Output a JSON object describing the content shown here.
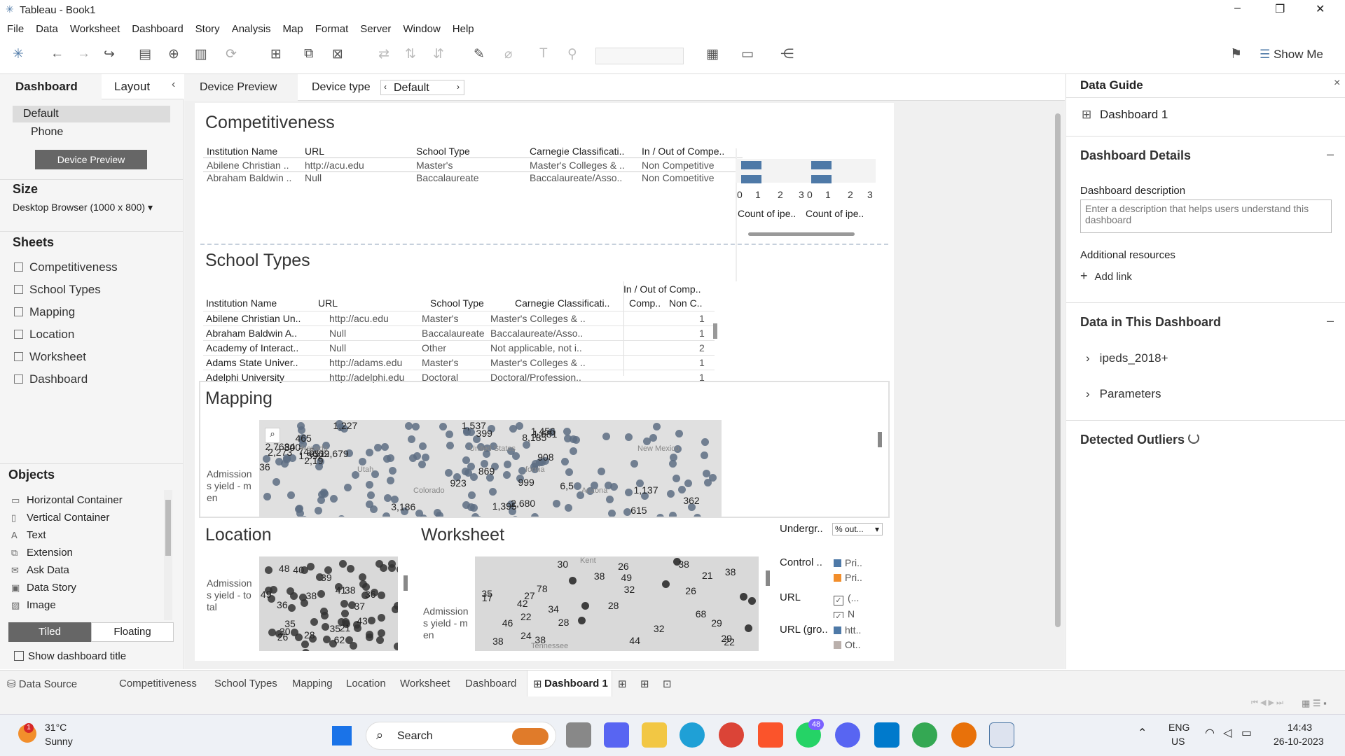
{
  "window": {
    "title": "Tableau - Book1",
    "min": "–",
    "max": "❐",
    "close": "✕"
  },
  "menu": [
    "File",
    "Data",
    "Worksheet",
    "Dashboard",
    "Story",
    "Analysis",
    "Map",
    "Format",
    "Server",
    "Window",
    "Help"
  ],
  "toolbar": {
    "show_me": "Show Me"
  },
  "left_panel": {
    "tab_dashboard": "Dashboard",
    "tab_layout": "Layout",
    "collapse": "‹",
    "device_default": "Default",
    "device_phone": "Phone",
    "device_preview_btn": "Device Preview",
    "size_title": "Size",
    "size_value": "Desktop Browser (1000 x 800)",
    "sheets_title": "Sheets",
    "sheets": [
      "Competitiveness",
      "School Types",
      "Mapping",
      "Location",
      "Worksheet",
      "Dashboard"
    ],
    "objects_title": "Objects",
    "objects": [
      {
        "icon": "▭",
        "label": "Horizontal Container"
      },
      {
        "icon": "▯",
        "label": "Vertical Container"
      },
      {
        "icon": "A",
        "label": "Text"
      },
      {
        "icon": "⧉",
        "label": "Extension"
      },
      {
        "icon": "✉",
        "label": "Ask Data"
      },
      {
        "icon": "▣",
        "label": "Data Story"
      },
      {
        "icon": "▨",
        "label": "Image"
      }
    ],
    "tiled": "Tiled",
    "floating": "Floating",
    "show_title": "Show dashboard title"
  },
  "dash_tabs": {
    "device_preview": "Device Preview",
    "device_type": "Device type",
    "device_type_value": "Default"
  },
  "competitiveness": {
    "title": "Competitiveness",
    "headers": [
      "Institution Name",
      "URL",
      "School Type",
      "Carnegie Classificati..",
      "In / Out of Compe.."
    ],
    "rows": [
      [
        "Abilene Christian ..",
        "http://acu.edu",
        "Master's",
        "Master's Colleges & ..",
        "Non Competitive"
      ],
      [
        "Abraham Baldwin ..",
        "Null",
        "Baccalaureate",
        "Baccalaureate/Asso..",
        "Non Competitive"
      ]
    ],
    "axis1": [
      "0",
      "1",
      "2",
      "3"
    ],
    "axis2": [
      "0",
      "1",
      "2",
      "3"
    ],
    "bars1": [
      1,
      1
    ],
    "bars2": [
      1,
      1
    ],
    "axis_label1": "Count of ipe..",
    "axis_label2": "Count of ipe.."
  },
  "school_types": {
    "title": "School Types",
    "super_header": "In / Out of Comp..",
    "headers": [
      "Institution Name",
      "URL",
      "School Type",
      "Carnegie Classificati..",
      "Comp..",
      "Non C.."
    ],
    "rows": [
      [
        "Abilene Christian Un..",
        "http://acu.edu",
        "Master's",
        "Master's Colleges & ..",
        "",
        "1"
      ],
      [
        "Abraham Baldwin A..",
        "Null",
        "Baccalaureate",
        "Baccalaureate/Asso..",
        "",
        "1"
      ],
      [
        "Academy of Interact..",
        "Null",
        "Other",
        "Not applicable, not i..",
        "",
        "2"
      ],
      [
        "Adams State Univer..",
        "http://adams.edu",
        "Master's",
        "Master's Colleges & ..",
        "",
        "1"
      ],
      [
        "Adelphi University",
        "http://adelphi.edu",
        "Doctoral",
        "Doctoral/Profession..",
        "",
        "1"
      ]
    ]
  },
  "mapping": {
    "title": "Mapping",
    "row_label": "Admission s yield - m en",
    "labels": [
      "999",
      "399",
      "36",
      "1,537",
      "1,681",
      "745",
      "923",
      "362",
      "1,227",
      "615",
      "1,137",
      "2,680",
      "2,273",
      "1,456",
      "908",
      "3,186",
      "8,185",
      "6,5",
      "2,7684",
      "309",
      "300",
      "869",
      "1,395",
      "1,592",
      "465",
      "2,679",
      "651",
      "2,19"
    ],
    "places": [
      "Nevada",
      "Utah",
      "Colorado",
      "United States",
      "fornia",
      "Arizona",
      "New Mexico"
    ]
  },
  "location": {
    "title": "Location",
    "row_label": "Admission s yield - to tal",
    "labels": [
      "49",
      "62",
      "38",
      "36",
      "40",
      "26",
      "48",
      "35",
      "21",
      "38",
      "36",
      "41",
      "30",
      "39",
      "28",
      "43",
      "37",
      "35"
    ]
  },
  "worksheet": {
    "title": "Worksheet",
    "row_label": "Admission s yield - m en",
    "labels": [
      "29",
      "21",
      "78",
      "68",
      "26",
      "28",
      "46",
      "28",
      "34",
      "35",
      "30",
      "38",
      "29",
      "49",
      "24",
      "22",
      "32",
      "38",
      "38",
      "32",
      "44",
      "38",
      "38",
      "22",
      "42",
      "26",
      "27",
      "17"
    ],
    "places": [
      "Kent",
      "Tennessee"
    ]
  },
  "legends": {
    "filter_title": "Undergr..",
    "filter_value": "% out...",
    "control_title": "Control ..",
    "control_items": [
      {
        "color": "#4e79a7",
        "label": "Pri.."
      },
      {
        "color": "#f28e2b",
        "label": "Pri.."
      }
    ],
    "url_title": "URL",
    "url_items": [
      {
        "checked": "✓",
        "label": "(..."
      },
      {
        "checked": "✓",
        "label": "N"
      }
    ],
    "urlg_title": "URL (gro..",
    "urlg_items": [
      {
        "color": "#4e79a7",
        "label": "htt.."
      },
      {
        "color": "#bab0ac",
        "label": "Ot.."
      }
    ]
  },
  "data_guide": {
    "title": "Data Guide",
    "close": "×",
    "dashboard_name": "Dashboard 1",
    "details_title": "Dashboard Details",
    "desc_label": "Dashboard description",
    "desc_placeholder": "Enter a description that helps users understand this dashboard",
    "resources": "Additional resources",
    "add_link": "Add link",
    "data_title": "Data in This Dashboard",
    "data_items": [
      "ipeds_2018+",
      "Parameters"
    ],
    "outliers": "Detected Outliers",
    "collapse": "–"
  },
  "bottom_tabs": {
    "data_source": "Data Source",
    "tabs": [
      "Competitiveness",
      "School Types",
      "Mapping",
      "Location",
      "Worksheet",
      "Dashboard"
    ],
    "active": "Dashboard 1"
  },
  "taskbar": {
    "temp": "31°C",
    "weather": "Sunny",
    "badge": "1",
    "search": "Search",
    "lang1": "ENG",
    "lang2": "US",
    "time": "14:43",
    "date": "26-10-2023",
    "wa_badge": "48"
  }
}
